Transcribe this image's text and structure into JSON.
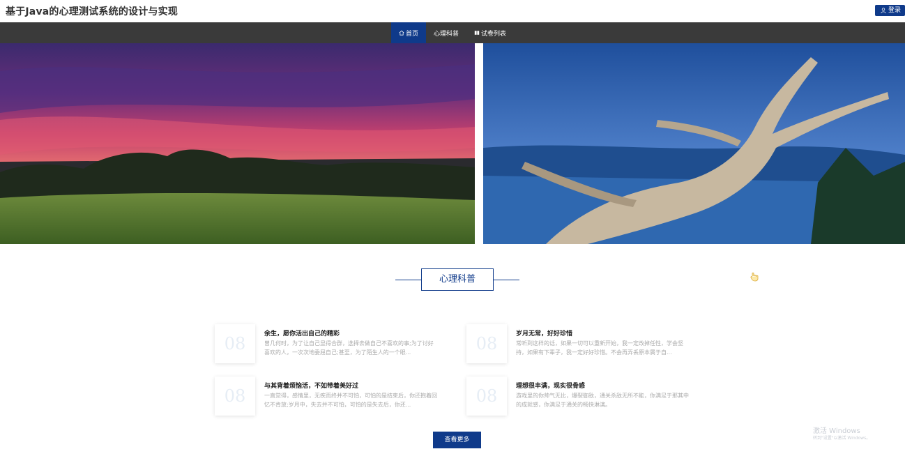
{
  "header": {
    "title": "基于Java的心理测试系统的设计与实现",
    "login_label": "登录"
  },
  "nav": {
    "items": [
      {
        "label": "首页",
        "icon": "home-icon",
        "active": true
      },
      {
        "label": "心理科普",
        "icon": "",
        "active": false
      },
      {
        "label": "试卷列表",
        "icon": "grid-icon",
        "active": false
      }
    ]
  },
  "section": {
    "title": "心理科普"
  },
  "articles": [
    {
      "thumb_text": "08",
      "title": "余生，愿你活出自己的精彩",
      "body": "曾几何时，为了让自己显得合群，选择去做自己不喜欢的事;为了讨好喜欢的人，一次次地委屈自己;甚至，为了陌生人的一个眼..."
    },
    {
      "thumb_text": "08",
      "title": "岁月无常，好好珍惜",
      "body": "常听到这样的话，如果一切可以重新开始，我一定改掉任性，学会坚持，如果有下辈子，我一定好好珍惜。不会再弄丢原本属于自..."
    },
    {
      "thumb_text": "08",
      "title": "与其背着烦恼活，不如带着美好过",
      "body": "一直觉得，感情里，无疾而终并不可怕，可怕的是结束后，你还抱着回忆不肯放;岁月中，失去并不可怕，可怕的是失去后，你还..."
    },
    {
      "thumb_text": "08",
      "title": "理想很丰满，现实很骨感",
      "body": "游戏里的你帅气无比，爆裂御敌，通关杀敌无所不能，你满足于那其中的成就感，你满足于通关的畅快淋漓。"
    }
  ],
  "more_label": "查看更多",
  "watermark": {
    "line1": "激活 Windows",
    "line2": "转到\"设置\"以激活 Windows。"
  },
  "colors": {
    "brand": "#0f3a8a",
    "navbar": "#3a3a3a"
  }
}
